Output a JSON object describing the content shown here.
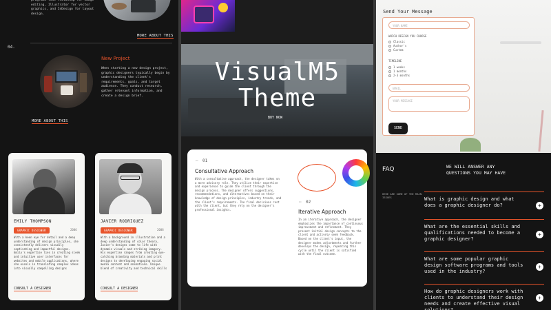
{
  "left": {
    "top_text": "programs like Photoshop for image editing, Illustrator for vector graphics, and InDesign for layout design.",
    "more_about_this_top": "MORE ABOUT THIS",
    "step_number": "04.",
    "project_title": "New Project",
    "project_text": "When starting a new design project, graphic designers typically begin by understanding the client's requirements, goals, and target audience. They conduct research, gather relevant information, and create a design brief.",
    "more_about_this": "MORE ABOUT THIS",
    "team": [
      {
        "name": "EMILY THOMPSON",
        "role": "GRAPHIC DESIGNER",
        "year": "2006",
        "bio": "With a keen eye for detail and a deep understanding of design principles, she consistently delivers visually captivating and impactful designs. Emily's expertise lies in creating sleek and intuitive user interfaces for websites and mobile applications, where she excels in translating complex ideas into visually compelling designs",
        "cta": "CONSULT A DESIGNER"
      },
      {
        "name": "JAVIER RODRIGUEZ",
        "role": "GRAPHIC DESIGNER",
        "year": "2008",
        "bio": "With a background in illustration and a deep understanding of color theory, Javier's designs come to life with dynamic visuals and striking imagery. His expertise ranges from creating eye-catching branding materials and print designs to developing engaging social media content and animations. Unique blend of creativity and technical skills",
        "cta": "CONSULT A DESIGNER"
      }
    ]
  },
  "middle": {
    "hero_title_line1": "VisualM5",
    "hero_title_line2": "Theme",
    "buy_now": "BUY NOW",
    "approaches": [
      {
        "num": "01",
        "title": "Consultative Approach",
        "text": "With a consultative approach, the designer takes on a more advisory role. They utilize their expertise and experience to guide the client through the design process. The designer offers suggestions, recommendations, and alternatives based on their knowledge of design principles, industry trends, and the client's requirements. The final decisions rest with the client, but they rely on the designer's professional insights."
      },
      {
        "num": "02",
        "title": "Iterative Approach",
        "text": "In an iterative approach, the designer emphasizes the importance of continuous improvement and refinement. They present initial design concepts to the client and actively seek feedback. Based on the client's input, the designer makes adjustments and further develops the design, repeating this cycle until the client is satisfied with the final outcome."
      }
    ]
  },
  "right": {
    "form_title": "Send Your Message",
    "name_placeholder": "YOUR NAME",
    "design_label": "WHICH DESIGN YOU CHOOSE",
    "design_options": [
      "Classic",
      "Author's",
      "Custom"
    ],
    "timeline_label": "TIMELINE",
    "timeline_options": [
      "1 weeks",
      "1 months",
      "2-3 months"
    ],
    "email_placeholder": "EMAIL",
    "message_placeholder": "YOUR MESSAGE",
    "send": "SEND",
    "faq_title": "FAQ",
    "faq_heading": "WE WILL ANSWER ANY QUESTIONS YOU MAY HAVE",
    "faq_subtext": "HERE ARE SOME OF THE MAIN ISSUES",
    "faqs": [
      "What is graphic design and what does a graphic designer do?",
      "What are the essential skills and qualifications needed to become a graphic designer?",
      "What are some popular graphic design software programs and tools used in the industry?",
      "How do graphic designers work with clients to understand their design needs and create effective visual solutions?"
    ]
  },
  "colors": {
    "accent": "#e8542b",
    "dark": "#141414",
    "card": "#f7f7f5"
  }
}
